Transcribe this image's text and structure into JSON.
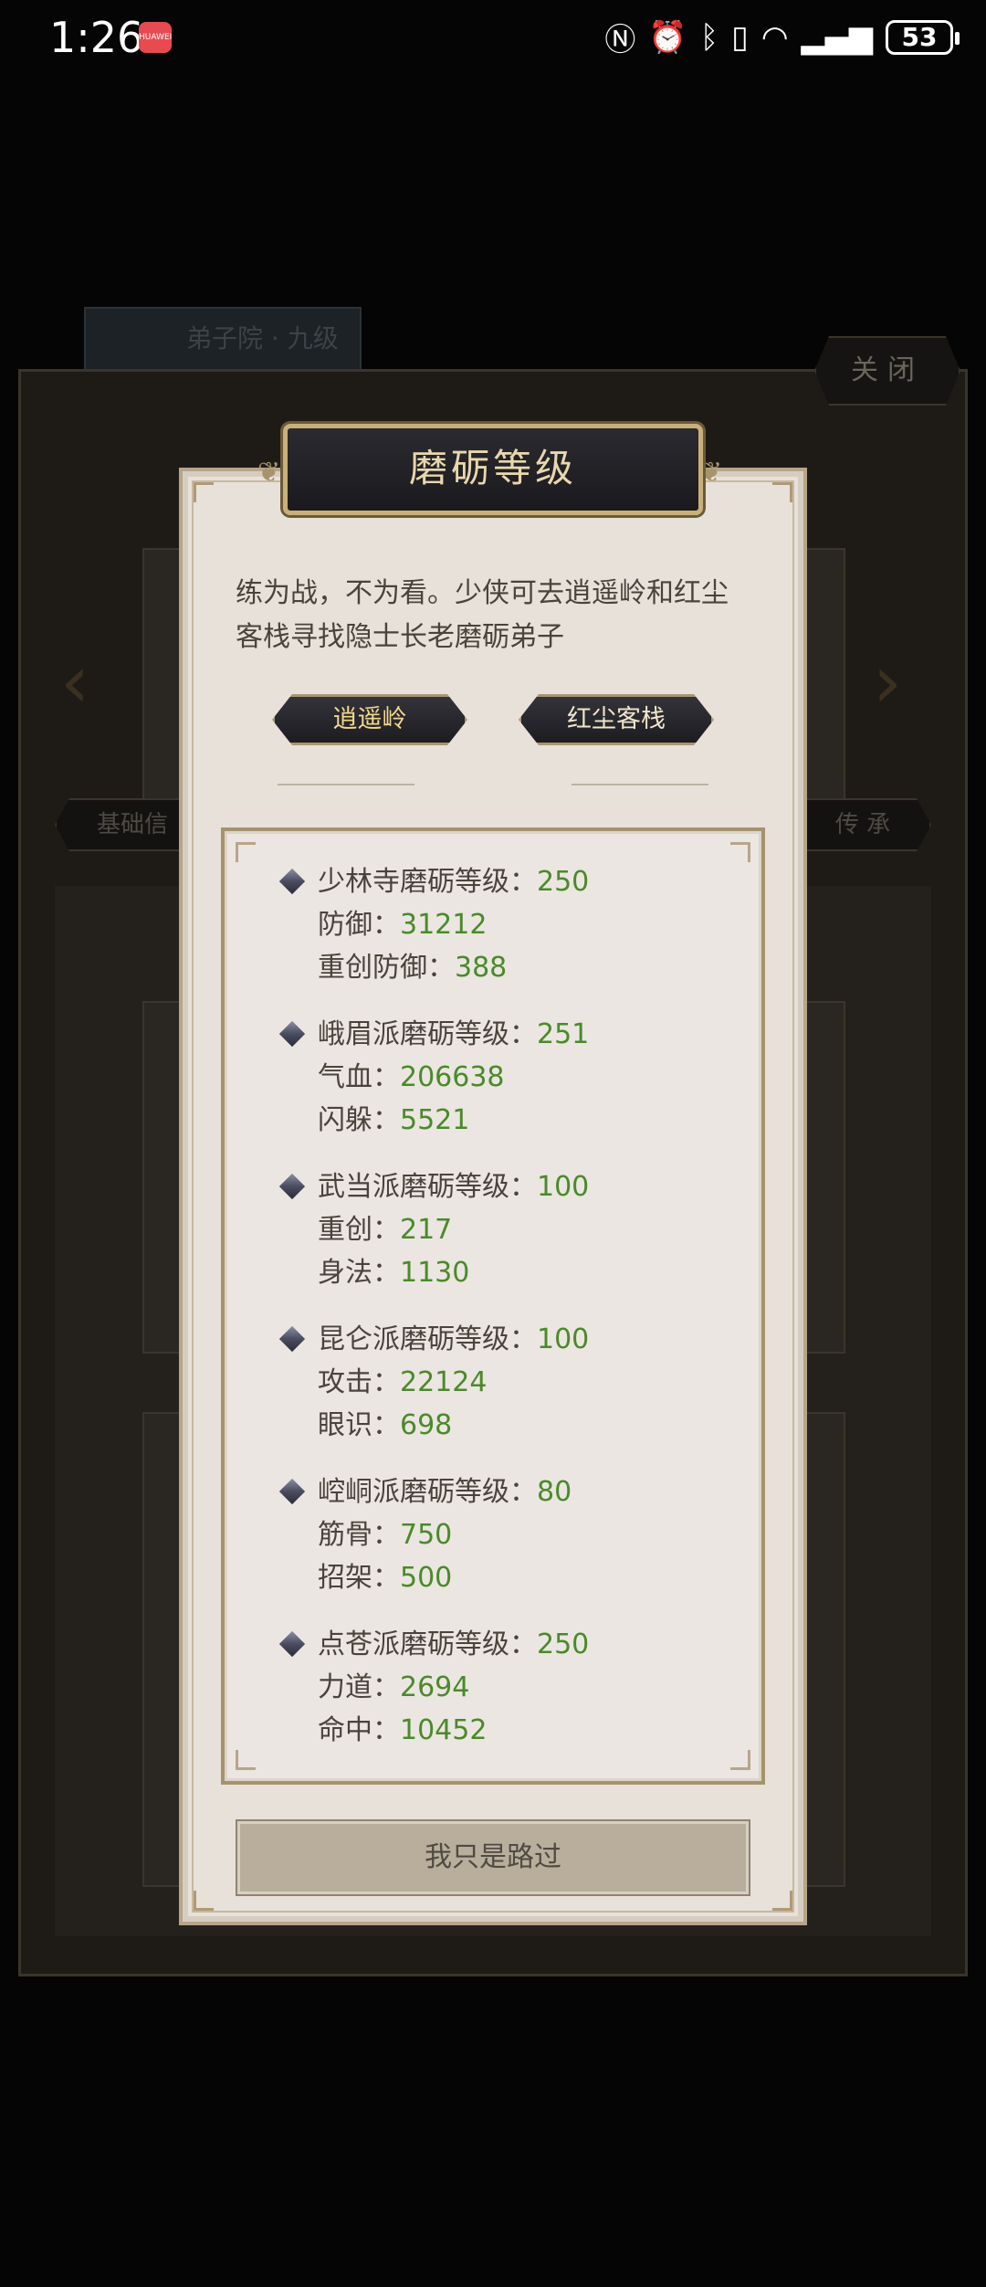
{
  "status_bar": {
    "time": "1:26",
    "app_badge": "HUAWEI",
    "icons": [
      "nfc-icon",
      "alarm-icon",
      "bluetooth-icon",
      "vibrate-icon",
      "wifi-icon",
      "signal-icon"
    ],
    "battery": "53"
  },
  "background": {
    "chip_label": "弟子院 · 九级",
    "close_label": "关闭",
    "tab_left": "基础信",
    "tab_right": "传 承"
  },
  "modal": {
    "title": "磨砺等级",
    "description": "练为战，不为看。少侠可去逍遥岭和红尘客栈寻找隐士长老磨砺弟子",
    "buttons": [
      "逍遥岭",
      "红尘客栈"
    ],
    "groups": [
      {
        "level_label": "少林寺磨砺等级：",
        "level_value": "250",
        "stats": [
          {
            "label": "防御：",
            "value": "31212"
          },
          {
            "label": "重创防御：",
            "value": "388"
          }
        ]
      },
      {
        "level_label": "峨眉派磨砺等级：",
        "level_value": "251",
        "stats": [
          {
            "label": "气血：",
            "value": "206638"
          },
          {
            "label": "闪躲：",
            "value": "5521"
          }
        ]
      },
      {
        "level_label": "武当派磨砺等级：",
        "level_value": "100",
        "stats": [
          {
            "label": "重创：",
            "value": "217"
          },
          {
            "label": "身法：",
            "value": "1130"
          }
        ]
      },
      {
        "level_label": "昆仑派磨砺等级：",
        "level_value": "100",
        "stats": [
          {
            "label": "攻击：",
            "value": "22124"
          },
          {
            "label": "眼识：",
            "value": "698"
          }
        ]
      },
      {
        "level_label": "崆峒派磨砺等级：",
        "level_value": "80",
        "stats": [
          {
            "label": "筋骨：",
            "value": "750"
          },
          {
            "label": "招架：",
            "value": "500"
          }
        ]
      },
      {
        "level_label": "点苍派磨砺等级：",
        "level_value": "250",
        "stats": [
          {
            "label": "力道：",
            "value": "2694"
          },
          {
            "label": "命中：",
            "value": "10452"
          }
        ]
      }
    ],
    "pass_button": "我只是路过"
  }
}
